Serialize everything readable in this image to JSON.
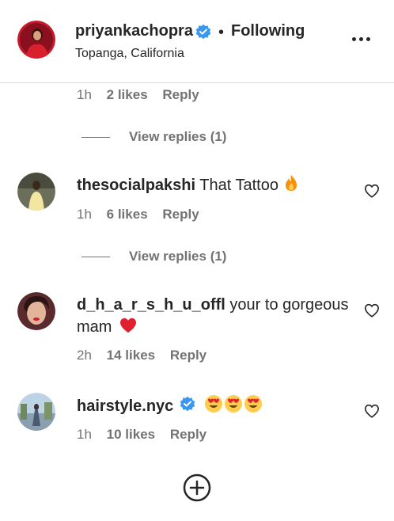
{
  "header": {
    "username": "priyankachopra",
    "separator": "•",
    "follow_status": "Following",
    "location": "Topanga, California"
  },
  "prev_comment": {
    "time": "1h",
    "likes": "2 likes",
    "reply": "Reply",
    "view_replies": "View replies (1)"
  },
  "comments": [
    {
      "username": "thesocialpakshi",
      "text": "That Tattoo",
      "time": "1h",
      "likes": "6 likes",
      "reply": "Reply",
      "view_replies": "View replies (1)"
    },
    {
      "username": "d_h_a_r_s_h_u_offl",
      "text": "your to gorgeous mam",
      "time": "2h",
      "likes": "14 likes",
      "reply": "Reply"
    },
    {
      "username": "hairstyle.nyc",
      "text": "",
      "time": "1h",
      "likes": "10 likes",
      "reply": "Reply"
    }
  ],
  "icons": {
    "verified": "verified-badge-icon",
    "more": "more-options-icon",
    "heart": "heart-outline-icon",
    "fire": "fire-emoji-icon",
    "red_heart": "red-heart-emoji-icon",
    "heart_eyes": "heart-eyes-emoji-icon",
    "add": "add-circle-icon"
  },
  "colors": {
    "verified": "#3897f0",
    "meta": "#737373",
    "text": "#262626",
    "divider": "#dbdbdb"
  }
}
